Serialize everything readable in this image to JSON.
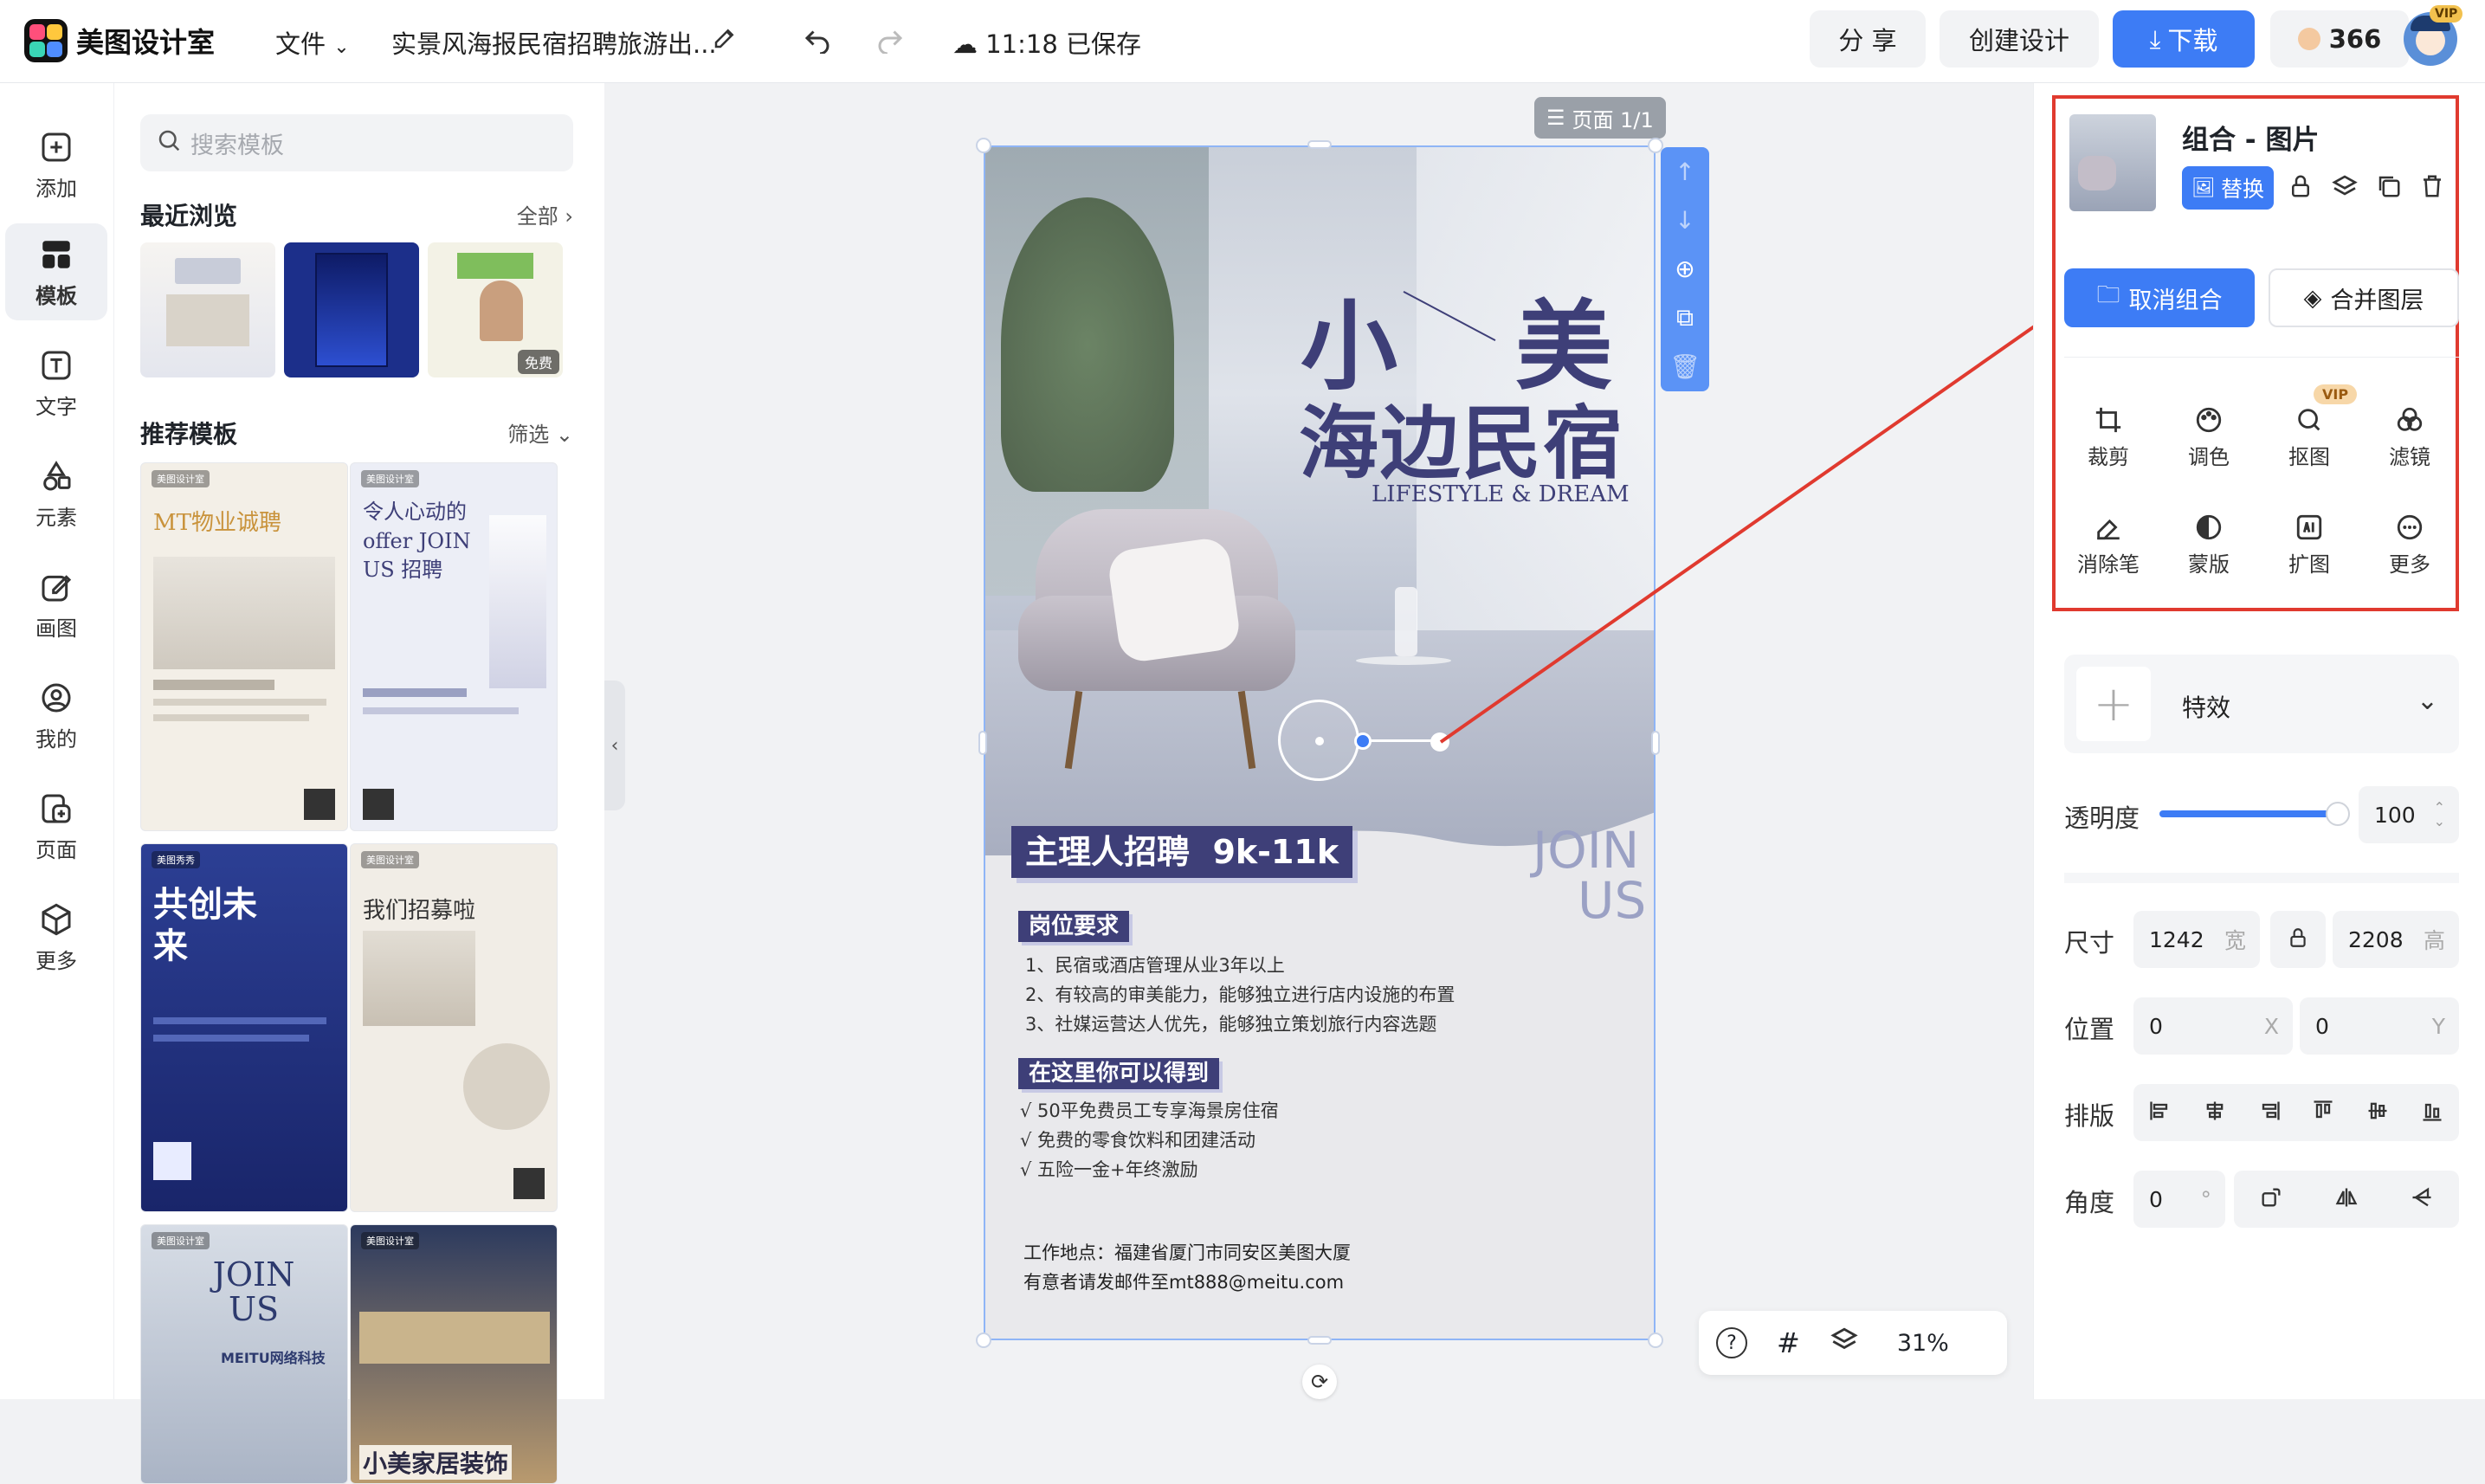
{
  "app": {
    "name": "美图设计室"
  },
  "topbar": {
    "file_menu": "文件",
    "doc_title": "实景风海报民宿招聘旅游出...",
    "save_status": "11:18 已保存",
    "share_label": "分 享",
    "create_label": "创建设计",
    "download_label": "下载",
    "credits": "366",
    "vip_badge": "VIP"
  },
  "rail": {
    "items": [
      {
        "label": "添加",
        "icon": "plus-square-icon"
      },
      {
        "label": "模板",
        "icon": "template-grid-icon"
      },
      {
        "label": "文字",
        "icon": "text-icon"
      },
      {
        "label": "元素",
        "icon": "shapes-icon"
      },
      {
        "label": "画图",
        "icon": "pen-edit-icon"
      },
      {
        "label": "我的",
        "icon": "user-icon"
      },
      {
        "label": "页面",
        "icon": "page-add-icon"
      },
      {
        "label": "更多",
        "icon": "cube-icon"
      }
    ]
  },
  "template_panel": {
    "search_placeholder": "搜索模板",
    "recent_title": "最近浏览",
    "recent_link": "全部",
    "recent_free_badge": "免费",
    "recommend_title": "推荐模板",
    "recommend_link": "筛选",
    "cards": [
      {
        "headline": "MT物业诚聘",
        "brand": "美图设计室"
      },
      {
        "headline": "令人心动的offer JOIN US 招聘",
        "brand": "美图设计室"
      },
      {
        "headline": "共创未来",
        "brand": "美图秀秀"
      },
      {
        "headline": "我们招募啦",
        "brand": "美图设计室"
      },
      {
        "headline": "JOIN US",
        "brand": "美图设计室",
        "sub": "MEITU网络科技"
      },
      {
        "headline": "小美家居装饰",
        "brand": "美图设计室"
      }
    ]
  },
  "canvas": {
    "page_badge": "页面 1/1",
    "zoom": "31%"
  },
  "poster": {
    "title_line1_a": "小",
    "title_line1_b": "美",
    "title_line2": "海边民宿",
    "subtitle": "LIFESTYLE & DREAM",
    "banner": "主理人招聘  9k-11k",
    "join": "JOIN",
    "us": "US",
    "req_title": "岗位要求",
    "requirements": [
      "1、民宿或酒店管理从业3年以上",
      "2、有较高的审美能力，能够独立进行店内设施的布置",
      "3、社媒运营达人优先，能够独立策划旅行内容选题"
    ],
    "benefit_title": "在这里你可以得到",
    "benefits": [
      "√ 50平免费员工专享海景房住宿",
      "√ 免费的零食饮料和团建活动",
      "√ 五险一金+年终激励"
    ],
    "address": "工作地点：福建省厦门市同安区美图大厦",
    "email": "有意者请发邮件至mt888@meitu.com"
  },
  "right_panel": {
    "layer_title": "组合 - 图片",
    "replace_label": "替换",
    "ungroup_label": "取消组合",
    "merge_label": "合并图层",
    "tools": [
      {
        "label": "裁剪",
        "icon": "crop-icon"
      },
      {
        "label": "调色",
        "icon": "palette-icon"
      },
      {
        "label": "抠图",
        "icon": "cutout-icon",
        "badge": "VIP"
      },
      {
        "label": "滤镜",
        "icon": "filter-icon"
      },
      {
        "label": "消除笔",
        "icon": "eraser-icon"
      },
      {
        "label": "蒙版",
        "icon": "mask-icon"
      },
      {
        "label": "扩图",
        "icon": "ai-expand-icon"
      },
      {
        "label": "更多",
        "icon": "more-icon"
      }
    ],
    "effects_label": "特效",
    "opacity_label": "透明度",
    "opacity_value": "100",
    "opacity_level": 1.0,
    "size_label": "尺寸",
    "width": "1242",
    "width_suffix": "宽",
    "height": "2208",
    "height_suffix": "高",
    "position_label": "位置",
    "pos_x": "0",
    "pos_x_suffix": "X",
    "pos_y": "0",
    "pos_y_suffix": "Y",
    "arrange_label": "排版",
    "angle_label": "角度",
    "angle_value": "0",
    "angle_suffix": "°"
  },
  "colors": {
    "accent": "#3d7cf5",
    "annotation_red": "#e03a2f",
    "poster_navy": "#3e3f78"
  }
}
